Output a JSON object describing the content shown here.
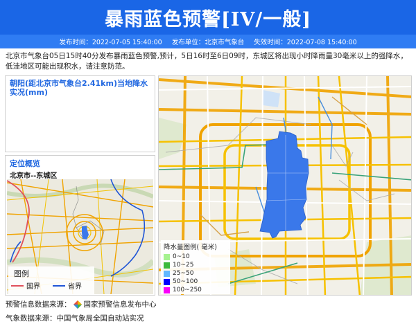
{
  "header": {
    "title": "暴雨蓝色预警[IV/一般]",
    "publish_time": "发布时间：2022-07-05 15:40:00",
    "publisher": "发布单位：北京市气象台",
    "expire_time": "失效时间：2022-07-08 15:40:00"
  },
  "description": "北京市气象台05日15时40分发布暴雨蓝色预警,预计，5日16时至6日09时，东城区将出现小时降雨量30毫米以上的强降水，低洼地区可能出现积水，请注意防范。",
  "rain_panel": {
    "title": "朝阳(距北京市气象台2.41km)当地降水实况(mm)"
  },
  "location_panel": {
    "title": "定位概览",
    "subtitle": "北京市--东城区",
    "legend": {
      "title": "图例",
      "items": [
        {
          "label": "国界",
          "color": "#e0505a"
        },
        {
          "label": "省界",
          "color": "#1f55d6"
        }
      ]
    }
  },
  "rain_legend": {
    "title": "降水量图例( 毫米)",
    "items": [
      {
        "label": "0~10",
        "color": "#a6f28f"
      },
      {
        "label": "10~25",
        "color": "#3dba3d"
      },
      {
        "label": "25~50",
        "color": "#61b8ff"
      },
      {
        "label": "50~100",
        "color": "#0000fe"
      },
      {
        "label": "100~250",
        "color": "#fa00fa"
      }
    ]
  },
  "warning_area": {
    "color": "#3a78ea"
  },
  "footer": {
    "warning_source_label": "预警信息数据来源：",
    "warning_source": "国家预警信息发布中心",
    "weather_source": "气象数据来源：中国气象局全国自动站实况"
  }
}
